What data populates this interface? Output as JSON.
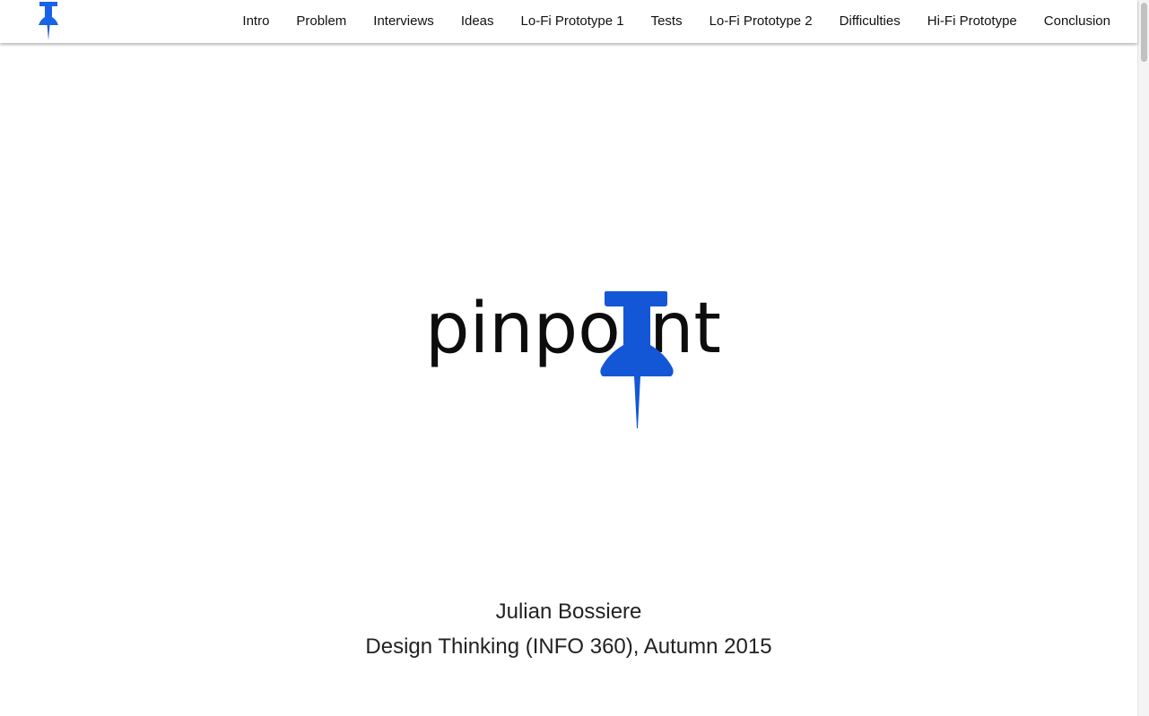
{
  "navbar": {
    "logo_icon": "pushpin-icon",
    "links": [
      {
        "label": "Intro"
      },
      {
        "label": "Problem"
      },
      {
        "label": "Interviews"
      },
      {
        "label": "Ideas"
      },
      {
        "label": "Lo-Fi Prototype 1"
      },
      {
        "label": "Tests"
      },
      {
        "label": "Lo-Fi Prototype 2"
      },
      {
        "label": "Difficulties"
      },
      {
        "label": "Hi-Fi Prototype"
      },
      {
        "label": "Conclusion"
      }
    ]
  },
  "hero": {
    "wordmark": "pinpoint",
    "wordmark_before_pin": "pinpo",
    "wordmark_after_pin": "nt",
    "pin_icon": "pushpin-icon"
  },
  "author": {
    "name": "Julian Bossiere",
    "course": "Design Thinking (INFO 360), Autumn 2015"
  },
  "colors": {
    "accent": "#1457d6",
    "nav_logo": "#1a63e6",
    "text": "#111111"
  }
}
